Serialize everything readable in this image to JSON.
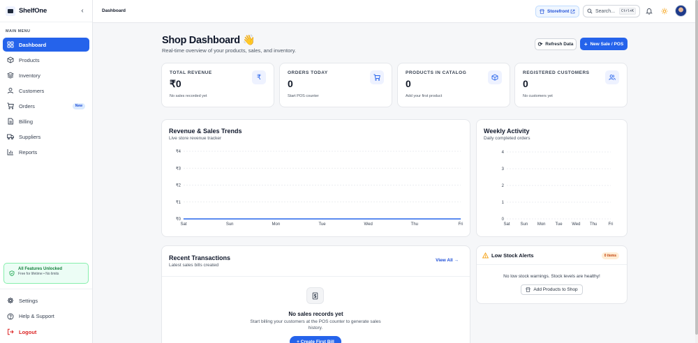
{
  "brand": {
    "name": "ShelfOne",
    "collapse_icon": "chevron-left-icon"
  },
  "sidebar": {
    "menu_title": "MAIN MENU",
    "items": [
      {
        "label": "Dashboard",
        "icon": "dashboard-grid-icon",
        "active": true
      },
      {
        "label": "Products",
        "icon": "package-icon"
      },
      {
        "label": "Inventory",
        "icon": "layers-icon"
      },
      {
        "label": "Customers",
        "icon": "user-icon"
      },
      {
        "label": "Orders",
        "icon": "cart-icon",
        "badge": "New"
      },
      {
        "label": "Billing",
        "icon": "file-icon"
      },
      {
        "label": "Suppliers",
        "icon": "truck-icon"
      },
      {
        "label": "Reports",
        "icon": "bar-chart-icon"
      }
    ],
    "unlock": {
      "title": "All Features Unlocked",
      "subtitle": "Free for lifetime • No limits"
    },
    "bottom": [
      {
        "label": "Settings",
        "icon": "gear-icon"
      },
      {
        "label": "Help & Support",
        "icon": "help-circle-icon"
      },
      {
        "label": "Logout",
        "icon": "logout-icon"
      }
    ]
  },
  "topbar": {
    "breadcrumb": "Dashboard",
    "storefront_label": "Storefront",
    "search_placeholder": "Search...",
    "search_shortcut": "Ctrl+K"
  },
  "header": {
    "title": "Shop Dashboard 👋",
    "subtitle": "Real-time overview of your products, sales, and inventory.",
    "refresh_label": "Refresh Data",
    "new_sale_label": "New Sale / POS"
  },
  "stats": [
    {
      "label": "TOTAL REVENUE",
      "value": "₹0",
      "hint": "No sales recorded yet",
      "icon": "rupee-icon"
    },
    {
      "label": "ORDERS TODAY",
      "value": "0",
      "hint": "Start POS counter",
      "icon": "cart-icon"
    },
    {
      "label": "PRODUCTS IN CATALOG",
      "value": "0",
      "hint": "Add your first product",
      "icon": "box-icon"
    },
    {
      "label": "REGISTERED CUSTOMERS",
      "value": "0",
      "hint": "No customers yet",
      "icon": "users-icon"
    }
  ],
  "charts": {
    "revenue": {
      "title": "Revenue & Sales Trends",
      "subtitle": "Live store revenue tracker"
    },
    "weekly": {
      "title": "Weekly Activity",
      "subtitle": "Daily completed orders"
    }
  },
  "chart_data": [
    {
      "type": "line",
      "title": "Revenue & Sales Trends",
      "subtitle": "Live store revenue tracker",
      "x": [
        "Sat",
        "Sun",
        "Mon",
        "Tue",
        "Wed",
        "Thu",
        "Fri"
      ],
      "y_ticks": [
        "₹0",
        "₹1",
        "₹2",
        "₹3",
        "₹4"
      ],
      "values": [
        0,
        0,
        0,
        0,
        0,
        0,
        0
      ],
      "ylim": [
        0,
        4
      ],
      "grid": true,
      "color": "#2563eb"
    },
    {
      "type": "bar",
      "title": "Weekly Activity",
      "subtitle": "Daily completed orders",
      "categories": [
        "Sat",
        "Sun",
        "Mon",
        "Tue",
        "Wed",
        "Thu",
        "Fri"
      ],
      "y_ticks": [
        "0",
        "1",
        "2",
        "3",
        "4"
      ],
      "values": [
        0,
        0,
        0,
        0,
        0,
        0,
        0
      ],
      "ylim": [
        0,
        4
      ],
      "grid": true
    }
  ],
  "transactions": {
    "title": "Recent Transactions",
    "subtitle": "Latest sales bills created",
    "view_all": "View All →",
    "empty_title": "No sales records yet",
    "empty_text": "Start billing your customers at the POS counter to generate sales history.",
    "create_label": "+ Create First Bill"
  },
  "alerts": {
    "title": "Low Stock Alerts",
    "badge": "0 items",
    "text": "No low stock warnings. Stock levels are healthy!",
    "button": "Add Products to Shop"
  },
  "colors": {
    "accent": "#2563eb",
    "success": "#15803d",
    "danger": "#dc2626",
    "warning": "#f59e0b"
  }
}
